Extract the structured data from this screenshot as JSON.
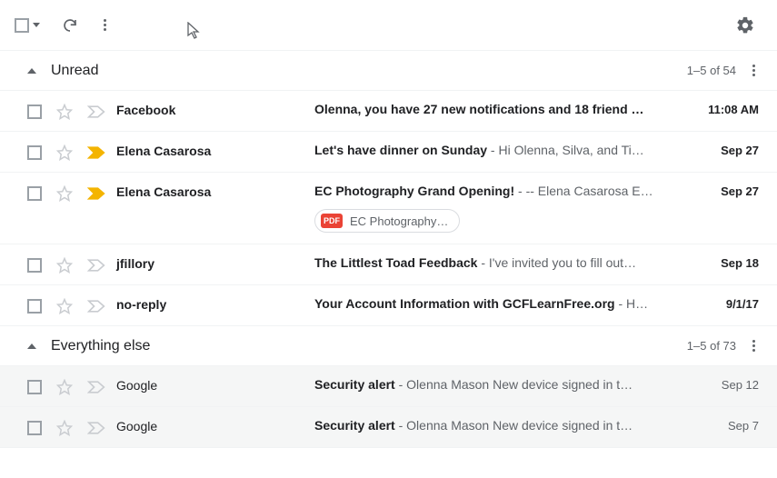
{
  "sections": [
    {
      "title": "Unread",
      "count_label": "1–5 of 54",
      "rows": [
        {
          "sender": "Facebook",
          "subject": "Olenna, you have 27 new notifications and 18 friend …",
          "preview": "",
          "date": "11:08 AM",
          "important": false,
          "read": false,
          "attachment": null
        },
        {
          "sender": "Elena Casarosa",
          "subject": "Let's have dinner on Sunday",
          "preview": " - Hi Olenna, Silva, and Ti…",
          "date": "Sep 27",
          "important": true,
          "read": false,
          "attachment": null
        },
        {
          "sender": "Elena Casarosa",
          "subject": "EC Photography Grand Opening!",
          "preview": " - -- Elena Casarosa E…",
          "date": "Sep 27",
          "important": true,
          "read": false,
          "attachment": {
            "type": "PDF",
            "name": "EC Photography…"
          }
        },
        {
          "sender": "jfillory",
          "subject": "The Littlest Toad Feedback",
          "preview": " - I've invited you to fill out…",
          "date": "Sep 18",
          "important": false,
          "read": false,
          "attachment": null
        },
        {
          "sender": "no-reply",
          "subject": "Your Account Information with GCFLearnFree.org",
          "preview": " - H…",
          "date": "9/1/17",
          "important": false,
          "read": false,
          "attachment": null
        }
      ]
    },
    {
      "title": "Everything else",
      "count_label": "1–5 of 73",
      "rows": [
        {
          "sender": "Google",
          "subject": "Security alert",
          "preview": " - Olenna Mason New device signed in t…",
          "date": "Sep 12",
          "important": false,
          "read": true,
          "attachment": null
        },
        {
          "sender": "Google",
          "subject": "Security alert",
          "preview": " - Olenna Mason New device signed in t…",
          "date": "Sep 7",
          "important": false,
          "read": true,
          "attachment": null
        }
      ]
    }
  ]
}
